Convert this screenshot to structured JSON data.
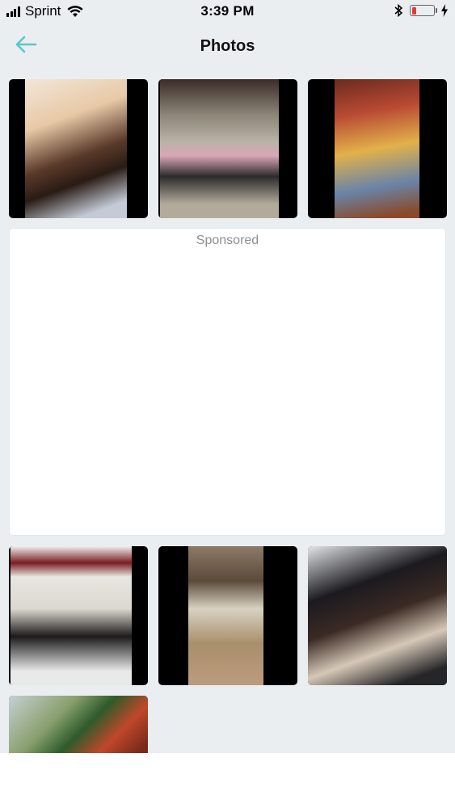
{
  "status_bar": {
    "carrier": "Sprint",
    "time": "3:39 PM",
    "battery_level": 0.2,
    "icons": [
      "signal-icon",
      "wifi-icon",
      "bluetooth-icon",
      "battery-icon",
      "charging-icon"
    ]
  },
  "nav": {
    "title": "Photos",
    "back_icon": "back-arrow-icon"
  },
  "colors": {
    "accent": "#5cc6cc",
    "background": "#ebeef0",
    "battery_low": "#e53935"
  },
  "ad": {
    "label": "Sponsored"
  },
  "photos": [
    {
      "name": "photo-1",
      "description_icon": "photo-thumbnail"
    },
    {
      "name": "photo-2",
      "description_icon": "photo-thumbnail"
    },
    {
      "name": "photo-3",
      "description_icon": "photo-thumbnail"
    },
    {
      "name": "photo-4",
      "description_icon": "photo-thumbnail"
    },
    {
      "name": "photo-5",
      "description_icon": "photo-thumbnail"
    },
    {
      "name": "photo-6",
      "description_icon": "photo-thumbnail"
    },
    {
      "name": "photo-7",
      "description_icon": "photo-thumbnail"
    }
  ]
}
